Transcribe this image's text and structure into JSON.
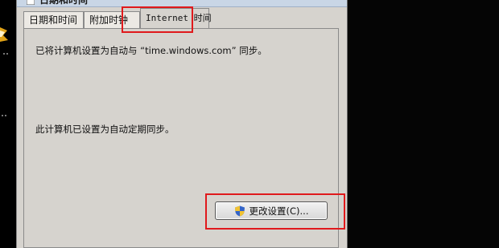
{
  "window": {
    "title": "日期和时间"
  },
  "tabs": [
    {
      "label": "日期和时间",
      "active": false
    },
    {
      "label": "附加时钟",
      "active": false
    },
    {
      "label": "Internet 时间",
      "active": true
    }
  ],
  "content": {
    "sync_status": "已将计算机设置为自动与 “time.windows.com” 同步。",
    "schedule_status": "此计算机已设置为自动定期同步。"
  },
  "buttons": {
    "change_settings": "更改设置(C)..."
  },
  "icons": {
    "window_icon": "calendar-icon",
    "button_icon": "uac-shield-icon"
  },
  "colors": {
    "highlight": "#e0191c",
    "dialog_bg": "#d6d3ce"
  }
}
